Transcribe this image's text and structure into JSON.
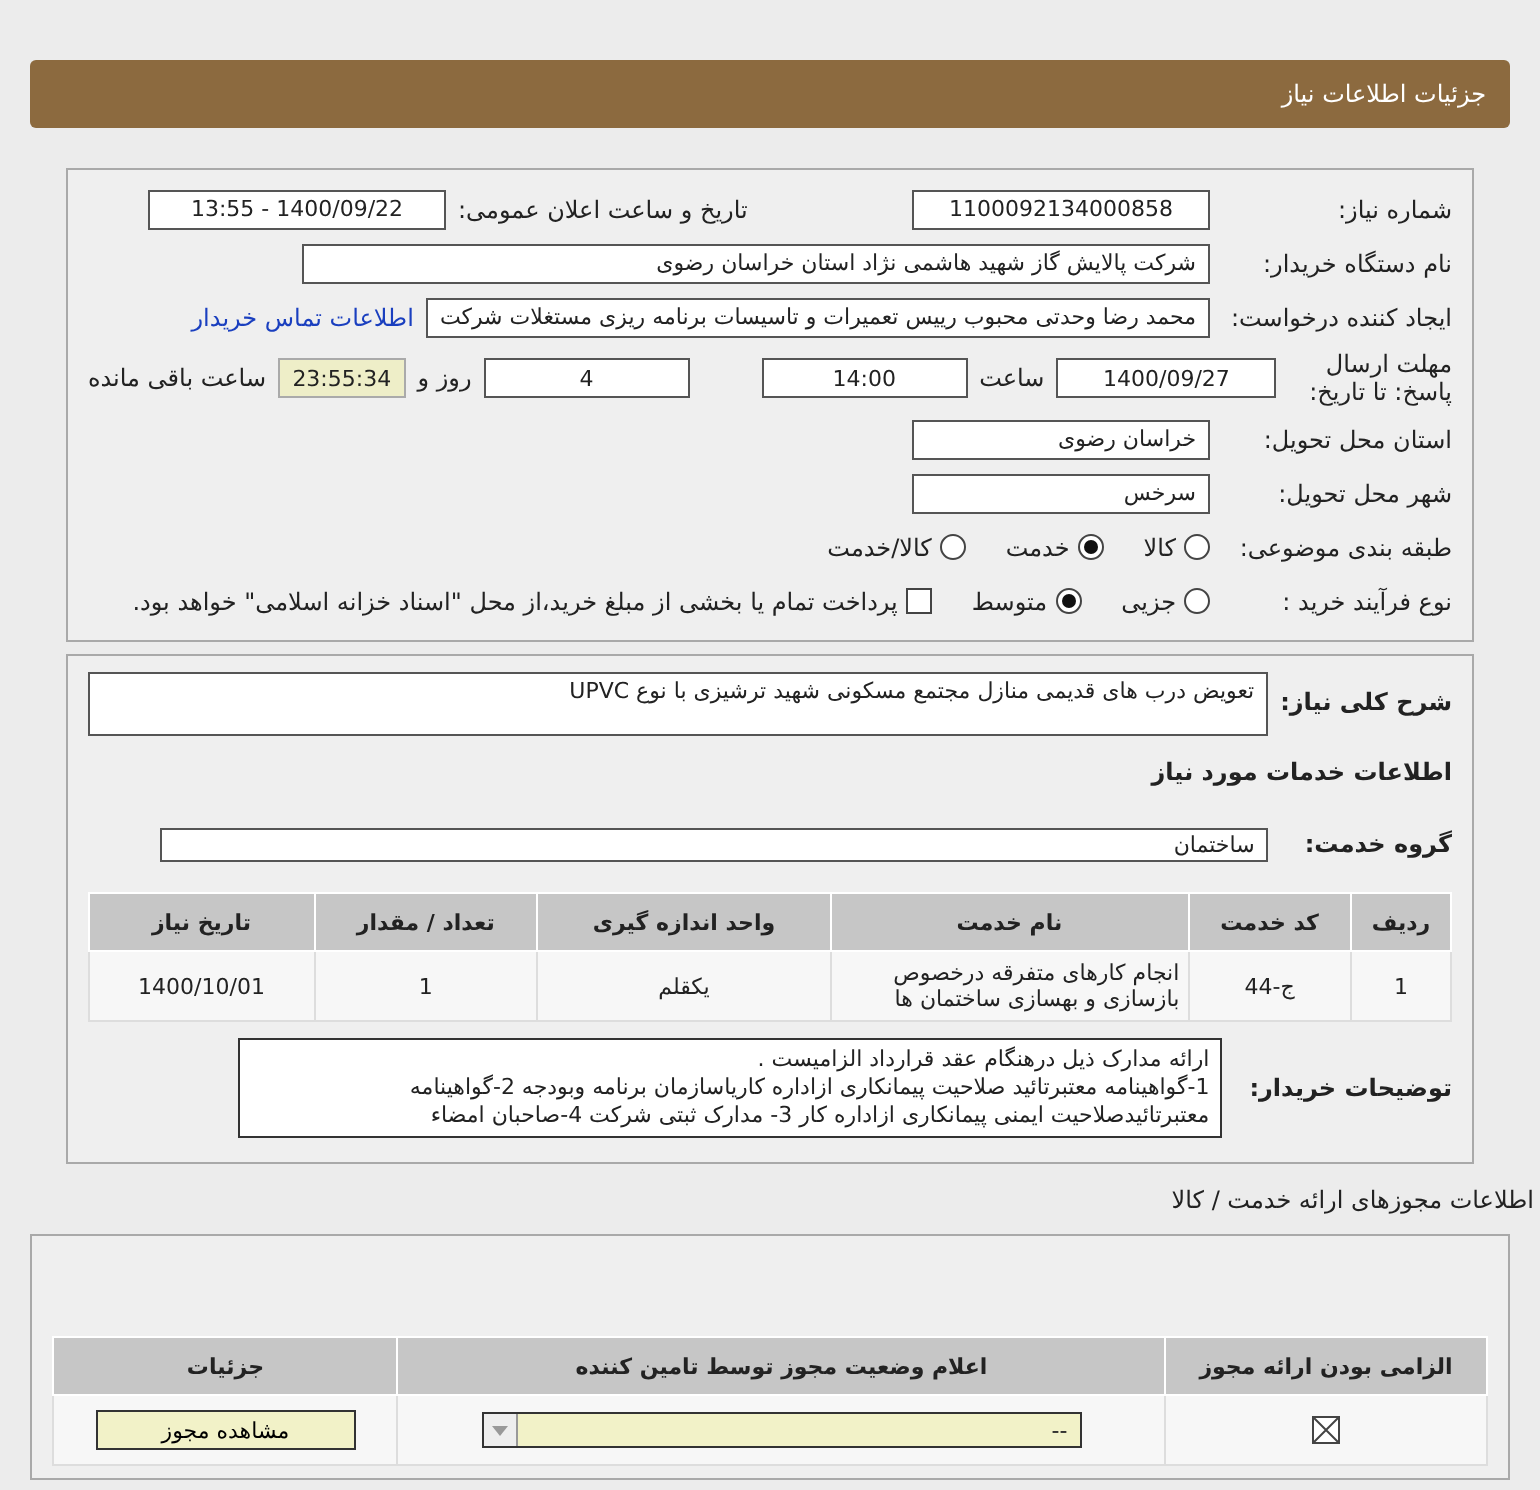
{
  "header": {
    "title": "جزئیات اطلاعات نیاز"
  },
  "need_number": {
    "label": "شماره نیاز:",
    "value": "1100092134000858"
  },
  "announce": {
    "label": "تاریخ و ساعت اعلان عمومی:",
    "value": "1400/09/22 - 13:55"
  },
  "buyer_org": {
    "label": "نام دستگاه خریدار:",
    "value": "شرکت پالایش گاز شهید هاشمی نژاد   استان خراسان رضوی"
  },
  "requester": {
    "label": "ایجاد کننده درخواست:",
    "value": "محمد رضا وحدتی محبوب رییس تعمیرات و تاسیسات برنامه ریزی مستغلات شرکت",
    "link": "اطلاعات تماس خریدار"
  },
  "deadline": {
    "label": "مهلت ارسال پاسخ: تا تاریخ:",
    "date": "1400/09/27",
    "time_label": "ساعت",
    "time": "14:00",
    "days": "4",
    "days_label": "روز و",
    "remaining": "23:55:34",
    "remaining_label": "ساعت باقی مانده"
  },
  "delivery_province": {
    "label": "استان محل تحویل:",
    "value": "خراسان رضوی"
  },
  "delivery_city": {
    "label": "شهر محل تحویل:",
    "value": "سرخس"
  },
  "category": {
    "label": "طبقه بندی موضوعی:",
    "options": [
      {
        "label": "کالا",
        "selected": false
      },
      {
        "label": "خدمت",
        "selected": true
      },
      {
        "label": "کالا/خدمت",
        "selected": false
      }
    ]
  },
  "process": {
    "label": "نوع فرآیند خرید :",
    "options": [
      {
        "label": "جزیی",
        "selected": false
      },
      {
        "label": "متوسط",
        "selected": true
      }
    ],
    "payment": {
      "label": "پرداخت تمام یا بخشی از مبلغ خرید،از محل \"اسناد خزانه اسلامی\" خواهد بود.",
      "checked": false
    }
  },
  "description": {
    "label": "شرح کلی نیاز:",
    "value": "تعویض درب های قدیمی منازل مجتمع مسکونی شهید ترشیزی با نوع UPVC"
  },
  "services_title": "اطلاعات خدمات مورد نیاز",
  "service_group": {
    "label": "گروه خدمت:",
    "value": "ساختمان"
  },
  "services_table": {
    "columns": [
      "ردیف",
      "کد خدمت",
      "نام خدمت",
      "واحد اندازه گیری",
      "تعداد / مقدار",
      "تاریخ نیاز"
    ],
    "rows": [
      [
        "1",
        "ج-44",
        "انجام کارهای متفرقه درخصوص بازسازی و بهسازی ساختمان ها",
        "یکقلم",
        "1",
        "1400/10/01"
      ]
    ]
  },
  "buyer_notes": {
    "label": "توضیحات خریدار:",
    "value": "ارائه مدارک ذیل درهنگام عقد قرارداد الزامیست .\n1-گواهینامه معتبرتائید صلاحیت پیمانکاری ازاداره کاریاسازمان برنامه وبودجه 2-گواهینامه\nمعتبرتائیدصلاحیت ایمنی پیمانکاری ازاداره کار 3- مدارک ثبتی شرکت 4-صاحبان امضاء"
  },
  "licenses_title": "اطلاعات مجوزهای ارائه خدمت / کالا",
  "licenses_table": {
    "columns": [
      "الزامی بودن ارائه مجوز",
      "اعلام وضعیت مجوز توسط تامین کننده",
      "جزئیات"
    ],
    "rows": [
      {
        "required": true,
        "status": "--",
        "details": "مشاهده مجوز"
      }
    ]
  }
}
